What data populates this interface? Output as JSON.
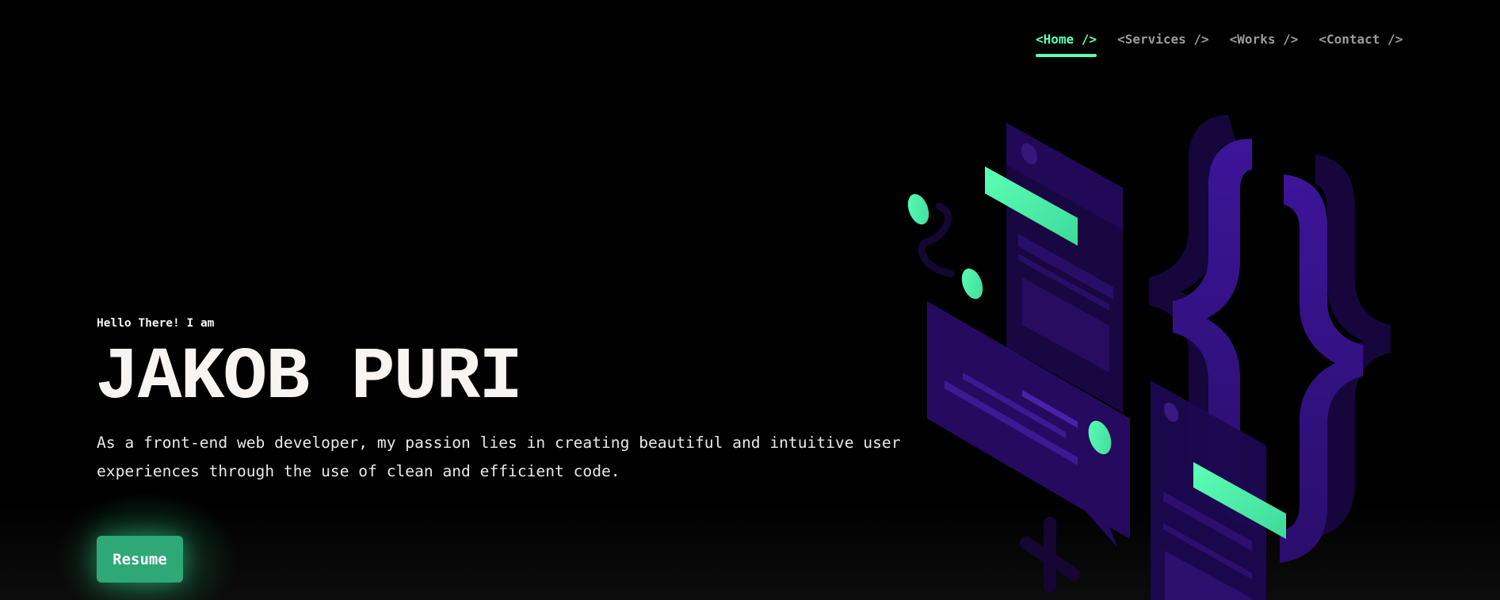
{
  "nav": {
    "items": [
      {
        "label": "<Home />",
        "active": true
      },
      {
        "label": "<Services />",
        "active": false
      },
      {
        "label": "<Works />",
        "active": false
      },
      {
        "label": "<Contact />",
        "active": false
      }
    ]
  },
  "hero": {
    "greeting": "Hello There! I am",
    "name": "JAKOB PURI",
    "bio": "As a front-end web developer, my passion lies in creating beautiful and intuitive user experiences through the use of clean and efficient code.",
    "resume_label": "Resume"
  },
  "illustration": {
    "icon": "code-braces-isometric-illustration"
  },
  "colors": {
    "accent": "#5cffb6",
    "button": "#2ea876",
    "background": "#000000",
    "illustration_purple": "#3a1490"
  }
}
